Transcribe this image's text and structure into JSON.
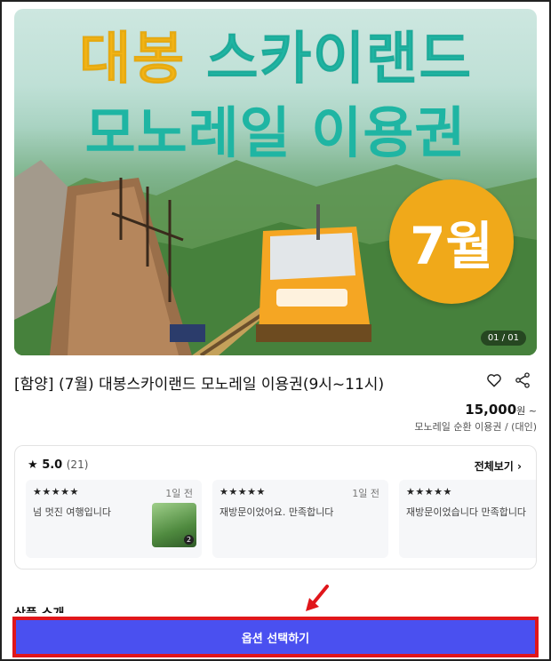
{
  "hero": {
    "title_line1_a": "대봉",
    "title_line1_b": "스카이랜드",
    "title_line2": "모노레일 이용권",
    "month_badge": "7월",
    "image_counter": "01 / 01"
  },
  "product": {
    "title": "[함양] (7월) 대봉스카이랜드 모노레일 이용권(9시~11시)",
    "price": "15,000",
    "price_unit": "원 ~",
    "price_sub": "모노레일 순환 이용권 / (대인)"
  },
  "reviews": {
    "rating": "5.0",
    "count": "(21)",
    "see_all": "전체보기",
    "items": [
      {
        "stars": "★★★★★",
        "ago": "1일 전",
        "text": "넘 멋진 여행입니다",
        "photo_count": "2"
      },
      {
        "stars": "★★★★★",
        "ago": "1일 전",
        "text": "재방문이었어요. 만족합니다"
      },
      {
        "stars": "★★★★★",
        "ago": "",
        "text": "재방문이었습니다 만족합니다"
      }
    ]
  },
  "section_peek": "상품 소개",
  "cta": {
    "label": "옵션 선택하기"
  },
  "colors": {
    "cta": "#4a50f0",
    "highlight": "#e0161b",
    "title_teal": "#1fb5a3",
    "title_yellow": "#f3b414",
    "badge": "#f0a91a"
  }
}
